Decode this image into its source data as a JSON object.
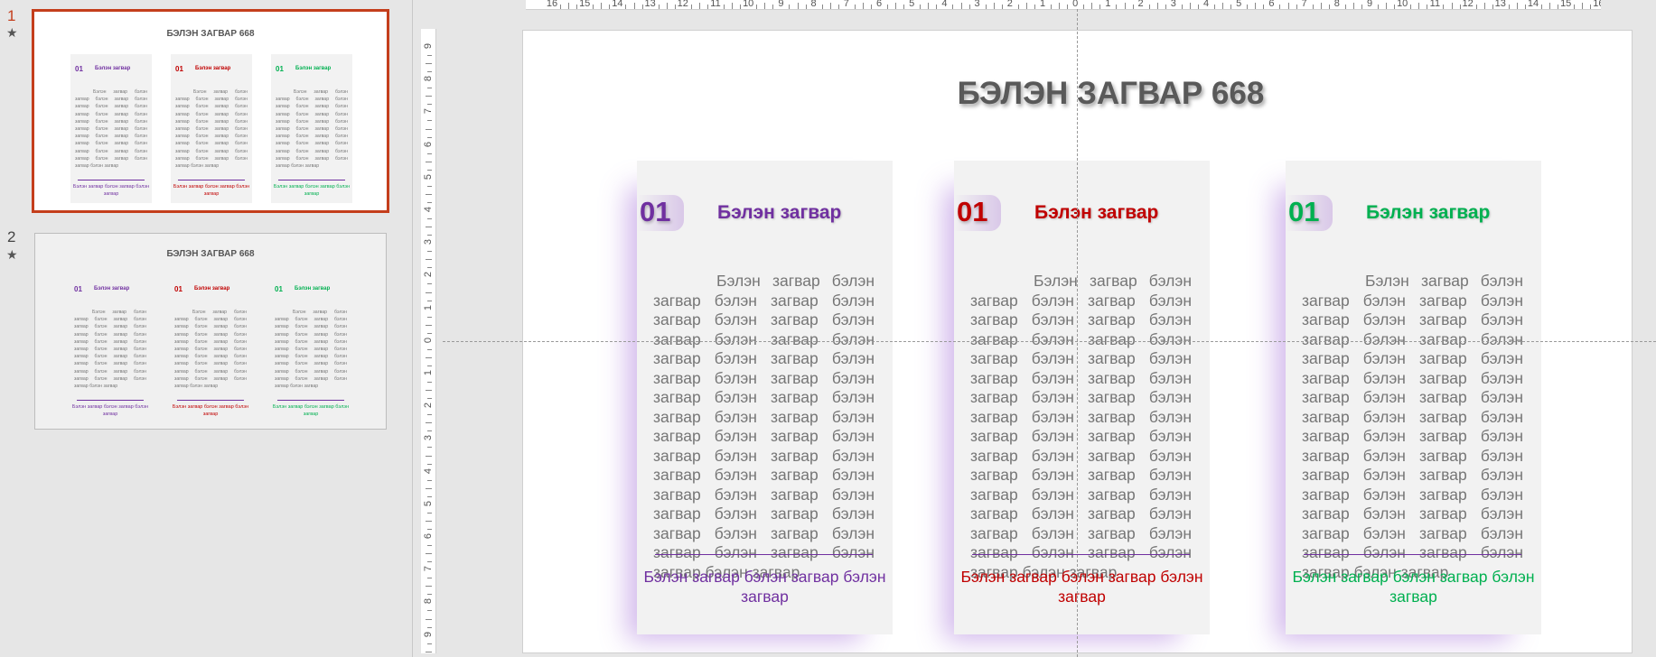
{
  "colors": {
    "accent": "#c43e1c",
    "purple": "#7030a0",
    "red": "#c00000",
    "green": "#00b050"
  },
  "thumbnails": [
    {
      "number": "1",
      "title": "БЭЛЭН ЗАГВАР 668",
      "cards": [
        {
          "num": "01",
          "head": "Бэлэн загвар",
          "body": "Бэлэн загвар бэлэн загвар бэлэн загвар бэлэн загвар бэлэн загвар бэлэн загвар бэлэн загвар бэлэн загвар бэлэн загвар бэлэн загвар бэлэн загвар бэлэн загвар бэлэн загвар бэлэн загвар бэлэн загвар бэлэн загвар бэлэн загвар бэлэн загвар бэлэн загвар бэлэн загвар бэлэн загвар",
          "foot": "Бэлэн загвар бэлэн загвар бэлэн загвар",
          "color": "#7030a0"
        },
        {
          "num": "01",
          "head": "Бэлэн загвар",
          "body": "Бэлэн загвар бэлэн загвар бэлэн загвар бэлэн загвар бэлэн загвар бэлэн загвар бэлэн загвар бэлэн загвар бэлэн загвар бэлэн загвар бэлэн загвар бэлэн загвар бэлэн загвар бэлэн загвар бэлэн загвар бэлэн загвар бэлэн загвар бэлэн загвар бэлэн загвар бэлэн загвар бэлэн загвар",
          "foot": "Бэлэн загвар бэлэн загвар бэлэн загвар",
          "color": "#c00000"
        },
        {
          "num": "01",
          "head": "Бэлэн загвар",
          "body": "Бэлэн загвар бэлэн загвар бэлэн загвар бэлэн загвар бэлэн загвар бэлэн загвар бэлэн загвар бэлэн загвар бэлэн загвар бэлэн загвар бэлэн загвар бэлэн загвар бэлэн загвар бэлэн загвар бэлэн загвар бэлэн загвар бэлэн загвар бэлэн загвар бэлэн загвар бэлэн загвар бэлэн загвар",
          "foot": "Бэлэн загвар бэлэн загвар бэлэн загвар",
          "color": "#00b050"
        }
      ]
    },
    {
      "number": "2",
      "title": "БЭЛЭН ЗАГВАР 668",
      "cards": [
        {
          "num": "01",
          "head": "Бэлэн загвар",
          "body": "Бэлэн загвар бэлэн загвар бэлэн загвар бэлэн загвар бэлэн загвар бэлэн загвар бэлэн загвар бэлэн загвар бэлэн загвар бэлэн загвар бэлэн загвар бэлэн загвар бэлэн загвар бэлэн загвар бэлэн загвар бэлэн загвар бэлэн загвар бэлэн загвар бэлэн загвар бэлэн загвар бэлэн загвар",
          "foot": "Бэлэн загвар бэлэн загвар бэлэн загвар",
          "color": "#7030a0"
        },
        {
          "num": "01",
          "head": "Бэлэн загвар",
          "body": "Бэлэн загвар бэлэн загвар бэлэн загвар бэлэн загвар бэлэн загвар бэлэн загвар бэлэн загвар бэлэн загвар бэлэн загвар бэлэн загвар бэлэн загвар бэлэн загвар бэлэн загвар бэлэн загвар бэлэн загвар бэлэн загвар бэлэн загвар бэлэн загвар бэлэн загвар бэлэн загвар бэлэн загвар",
          "foot": "Бэлэн загвар бэлэн загвар бэлэн загвар",
          "color": "#c00000"
        },
        {
          "num": "01",
          "head": "Бэлэн загвар",
          "body": "Бэлэн загвар бэлэн загвар бэлэн загвар бэлэн загвар бэлэн загвар бэлэн загвар бэлэн загвар бэлэн загвар бэлэн загвар бэлэн загвар бэлэн загвар бэлэн загвар бэлэн загвар бэлэн загвар бэлэн загвар бэлэн загвар бэлэн загвар бэлэн загвар бэлэн загвар бэлэн загвар бэлэн загвар",
          "foot": "Бэлэн загвар бэлэн загвар бэлэн загвар",
          "color": "#00b050"
        }
      ]
    }
  ],
  "ruler": {
    "top": [
      "16",
      "15",
      "14",
      "13",
      "12",
      "11",
      "10",
      "9",
      "8",
      "7",
      "6",
      "5",
      "4",
      "3",
      "2",
      "1",
      "0",
      "1",
      "2",
      "3",
      "4",
      "5",
      "6",
      "7",
      "8",
      "9",
      "10",
      "11",
      "12",
      "13",
      "14",
      "15",
      "16"
    ],
    "left": [
      "9",
      "8",
      "7",
      "6",
      "5",
      "4",
      "3",
      "2",
      "1",
      "0",
      "1",
      "2",
      "3",
      "4",
      "5",
      "6",
      "7",
      "8",
      "9"
    ]
  },
  "slide": {
    "title": "БЭЛЭН ЗАГВАР 668",
    "cards": [
      {
        "num": "01",
        "head": "Бэлэн загвар",
        "body": "Бэлэн загвар бэлэн загвар бэлэн загвар бэлэн загвар бэлэн загвар бэлэн загвар бэлэн загвар бэлэн загвар бэлэн загвар бэлэн загвар бэлэн загвар бэлэн загвар бэлэн загвар бэлэн загвар бэлэн загвар бэлэн загвар бэлэн загвар бэлэн загвар бэлэн загвар бэлэн загвар бэлэн загвар бэлэн загвар бэлэн загвар бэлэн загвар бэлэн загвар бэлэн загвар бэлэн загвар бэлэн загвар бэлэн загвар бэлэн загвар бэлэн загвар",
        "foot": "Бэлэн загвар бэлэн загвар бэлэн загвар",
        "color": "#7030a0"
      },
      {
        "num": "01",
        "head": "Бэлэн загвар",
        "body": "Бэлэн загвар бэлэн загвар бэлэн загвар бэлэн загвар бэлэн загвар бэлэн загвар бэлэн загвар бэлэн загвар бэлэн загвар бэлэн загвар бэлэн загвар бэлэн загвар бэлэн загвар бэлэн загвар бэлэн загвар бэлэн загвар бэлэн загвар бэлэн загвар бэлэн загвар бэлэн загвар бэлэн загвар бэлэн загвар бэлэн загвар бэлэн загвар бэлэн загвар бэлэн загвар бэлэн загвар бэлэн загвар бэлэн загвар бэлэн загвар бэлэн загвар",
        "foot": "Бэлэн загвар бэлэн загвар бэлэн загвар",
        "color": "#c00000"
      },
      {
        "num": "01",
        "head": "Бэлэн загвар",
        "body": "Бэлэн загвар бэлэн загвар бэлэн загвар бэлэн загвар бэлэн загвар бэлэн загвар бэлэн загвар бэлэн загвар бэлэн загвар бэлэн загвар бэлэн загвар бэлэн загвар бэлэн загвар бэлэн загвар бэлэн загвар бэлэн загвар бэлэн загвар бэлэн загвар бэлэн загвар бэлэн загвар бэлэн загвар бэлэн загвар бэлэн загвар бэлэн загвар бэлэн загвар бэлэн загвар бэлэн загвар бэлэн загвар бэлэн загвар бэлэн загвар бэлэн загвар",
        "foot": "Бэлэн загвар бэлэн загвар бэлэн загвар",
        "color": "#00b050"
      }
    ]
  }
}
